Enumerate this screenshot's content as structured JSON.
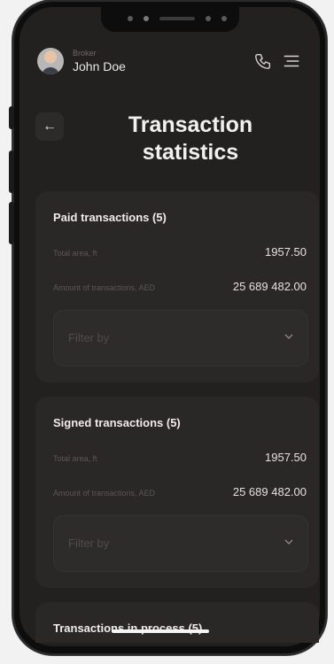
{
  "header": {
    "role": "Broker",
    "name": "John Doe",
    "phone_icon": "phone-icon",
    "menu_icon": "menu-icon"
  },
  "page": {
    "back_icon": "←",
    "title": "Transaction statistics"
  },
  "cards": [
    {
      "title": "Paid transactions (5)",
      "area_label": "Total area, ft",
      "area_value": "1957.50",
      "amount_label": "Amount of transactions, AED",
      "amount_value": "25 689 482.00",
      "filter_placeholder": "Filter by"
    },
    {
      "title": "Signed transactions (5)",
      "area_label": "Total area, ft",
      "area_value": "1957.50",
      "amount_label": "Amount of transactions, AED",
      "amount_value": "25 689 482.00",
      "filter_placeholder": "Filter by"
    },
    {
      "title": "Transactions in process (5)"
    }
  ],
  "colors": {
    "background": "#232120",
    "card": "#2a2826",
    "text": "#efece9",
    "muted": "#5a5754"
  }
}
